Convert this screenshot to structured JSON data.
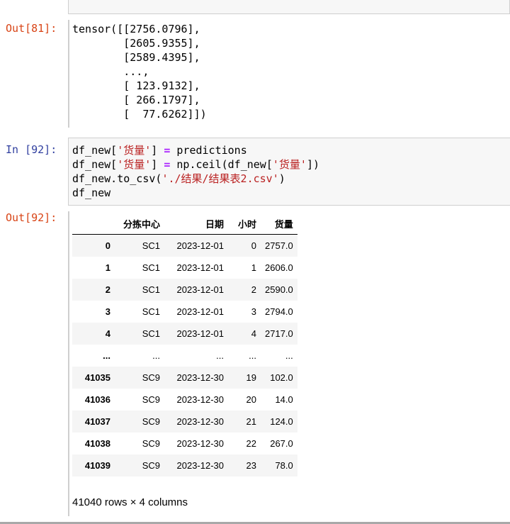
{
  "out81": {
    "prompt": "Out[81]:",
    "lines": [
      "tensor([[2756.0796],",
      "        [2605.9355],",
      "        [2589.4395],",
      "        ...,",
      "        [ 123.9132],",
      "        [ 266.1797],",
      "        [  77.6262]])"
    ]
  },
  "in92": {
    "prompt": "In [92]:",
    "code": [
      "df_new['货量'] = predictions",
      "df_new['货量'] = np.ceil(df_new['货量'])",
      "df_new.to_csv('./结果/结果表2.csv')",
      "df_new"
    ]
  },
  "out92": {
    "prompt": "Out[92]:",
    "columns": [
      "",
      "分拣中心",
      "日期",
      "小时",
      "货量"
    ],
    "rows": [
      [
        "0",
        "SC1",
        "2023-12-01",
        "0",
        "2757.0"
      ],
      [
        "1",
        "SC1",
        "2023-12-01",
        "1",
        "2606.0"
      ],
      [
        "2",
        "SC1",
        "2023-12-01",
        "2",
        "2590.0"
      ],
      [
        "3",
        "SC1",
        "2023-12-01",
        "3",
        "2794.0"
      ],
      [
        "4",
        "SC1",
        "2023-12-01",
        "4",
        "2717.0"
      ],
      [
        "...",
        "...",
        "...",
        "...",
        "..."
      ],
      [
        "41035",
        "SC9",
        "2023-12-30",
        "19",
        "102.0"
      ],
      [
        "41036",
        "SC9",
        "2023-12-30",
        "20",
        "14.0"
      ],
      [
        "41037",
        "SC9",
        "2023-12-30",
        "21",
        "124.0"
      ],
      [
        "41038",
        "SC9",
        "2023-12-30",
        "22",
        "267.0"
      ],
      [
        "41039",
        "SC9",
        "2023-12-30",
        "23",
        "78.0"
      ]
    ],
    "shape": "41040 rows × 4 columns"
  }
}
